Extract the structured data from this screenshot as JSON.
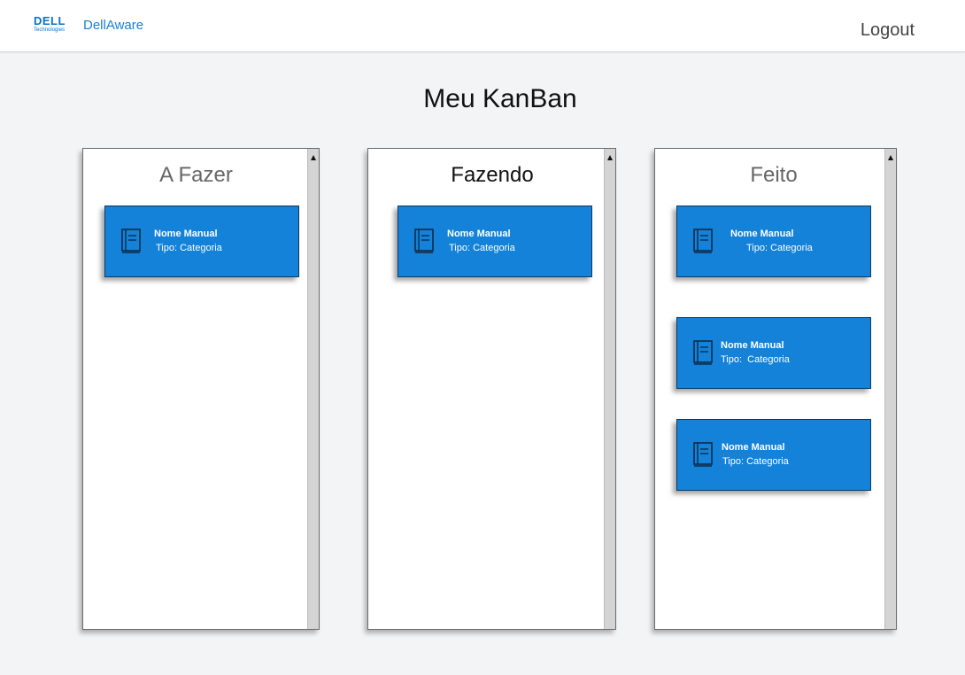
{
  "header": {
    "brand_word": "DELL",
    "brand_sub": "Technologies",
    "app_name": "DellAware",
    "logout_label": "Logout"
  },
  "page": {
    "title": "Meu KanBan"
  },
  "columns": [
    {
      "title": "A Fazer",
      "cards": [
        {
          "name": "Nome Manual",
          "type": "Tipo: Categoria"
        }
      ]
    },
    {
      "title": "Fazendo",
      "cards": [
        {
          "name": "Nome Manual",
          "type": "Tipo: Categoria"
        }
      ]
    },
    {
      "title": "Feito",
      "cards": [
        {
          "name": "Nome Manual",
          "type": "Tipo: Categoria"
        },
        {
          "name": "Nome Manual",
          "type": "Tipo:  Categoria"
        },
        {
          "name": "Nome Manual",
          "type": "Tipo: Categoria"
        }
      ]
    }
  ],
  "colors": {
    "card_blue": "#1382d8",
    "brand_blue": "#0a72c9",
    "page_bg": "#f3f4f6"
  },
  "icons": {
    "card": "book-icon",
    "scroll": "scroll-up-arrow-icon"
  }
}
